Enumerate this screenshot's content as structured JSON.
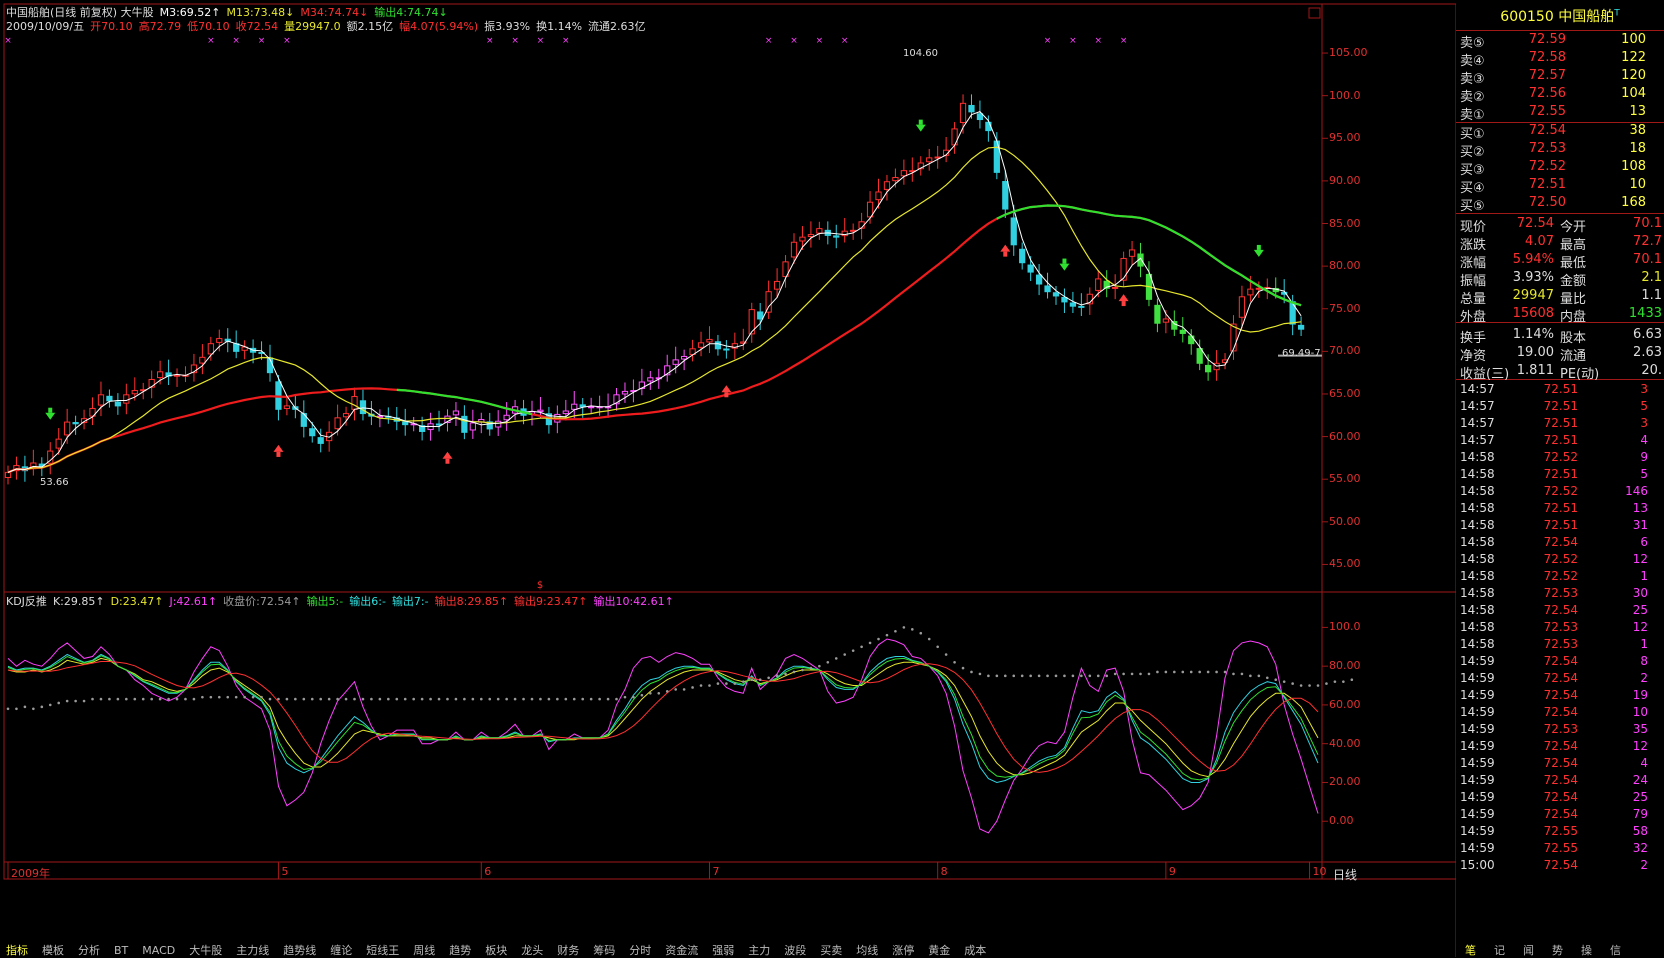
{
  "stock": {
    "code": "600150",
    "name": "中国船舶",
    "flag": "T"
  },
  "header": {
    "line1": [
      {
        "t": "中国船舶(日线 前复权) 大牛股",
        "c": "#dddddd"
      },
      {
        "t": "M3:69.52↑",
        "c": "#ffffff"
      },
      {
        "t": "M13:73.48↓",
        "c": "#e6e62e"
      },
      {
        "t": "M34:74.74↓",
        "c": "#ff3030"
      },
      {
        "t": "输出4:74.74↓",
        "c": "#30e030"
      }
    ],
    "line2": [
      {
        "t": "2009/10/09/五",
        "c": "#dddddd"
      },
      {
        "t": "开70.10",
        "c": "#ff3030"
      },
      {
        "t": "高72.79",
        "c": "#ff3030"
      },
      {
        "t": "低70.10",
        "c": "#ff3030"
      },
      {
        "t": "收72.54",
        "c": "#ff3030"
      },
      {
        "t": "量29947.0",
        "c": "#e6e62e"
      },
      {
        "t": "额2.15亿",
        "c": "#dddddd"
      },
      {
        "t": "幅4.07(5.94%)",
        "c": "#ff3030"
      },
      {
        "t": "振3.93%",
        "c": "#dddddd"
      },
      {
        "t": "换1.14%",
        "c": "#dddddd"
      },
      {
        "t": "流通2.63亿",
        "c": "#dddddd"
      }
    ]
  },
  "kdj_header": [
    {
      "t": "KDJ反推",
      "c": "#dddddd"
    },
    {
      "t": "K:29.85↑",
      "c": "#dddddd"
    },
    {
      "t": "D:23.47↑",
      "c": "#e6e62e"
    },
    {
      "t": "J:42.61↑",
      "c": "#ff40ff"
    },
    {
      "t": "收盘价:72.54↑",
      "c": "#9a9a9a"
    },
    {
      "t": "输出5:-",
      "c": "#30e030"
    },
    {
      "t": "输出6:-",
      "c": "#30e0e0"
    },
    {
      "t": "输出7:-",
      "c": "#30e0e0"
    },
    {
      "t": "输出8:29.85↑",
      "c": "#ff3030"
    },
    {
      "t": "输出9:23.47↑",
      "c": "#ff3030"
    },
    {
      "t": "输出10:42.61↑",
      "c": "#ff40ff"
    }
  ],
  "price_axis": [
    "105.00",
    "100.0",
    "95.00",
    "90.00",
    "85.00",
    "80.00",
    "75.00",
    "70.00",
    "65.00",
    "60.00",
    "55.00",
    "50.00",
    "45.00"
  ],
  "kdj_axis": [
    "100.0",
    "80.00",
    "60.00",
    "40.00",
    "20.00",
    "0.00"
  ],
  "x_labels": [
    "2009年",
    "5",
    "6",
    "7",
    "8",
    "9",
    "10"
  ],
  "annotations": {
    "high": "104.60",
    "low": "53.66",
    "last": "69.49-7"
  },
  "period_label": "日线",
  "quote": {
    "asks": [
      {
        "l": "卖⑤",
        "p": "72.59",
        "v": "100"
      },
      {
        "l": "卖④",
        "p": "72.58",
        "v": "122"
      },
      {
        "l": "卖③",
        "p": "72.57",
        "v": "120"
      },
      {
        "l": "卖②",
        "p": "72.56",
        "v": "104"
      },
      {
        "l": "卖①",
        "p": "72.55",
        "v": "13"
      }
    ],
    "bids": [
      {
        "l": "买①",
        "p": "72.54",
        "v": "38"
      },
      {
        "l": "买②",
        "p": "72.53",
        "v": "18"
      },
      {
        "l": "买③",
        "p": "72.52",
        "v": "108"
      },
      {
        "l": "买④",
        "p": "72.51",
        "v": "10"
      },
      {
        "l": "买⑤",
        "p": "72.50",
        "v": "168"
      }
    ],
    "stats": [
      {
        "l": "现价",
        "v": "72.54",
        "vc": "#ff3030",
        "l2": "今开",
        "v2": "70.1",
        "v2c": "#ff3030"
      },
      {
        "l": "涨跌",
        "v": "4.07",
        "vc": "#ff3030",
        "l2": "最高",
        "v2": "72.7",
        "v2c": "#ff3030"
      },
      {
        "l": "涨幅",
        "v": "5.94%",
        "vc": "#ff3030",
        "l2": "最低",
        "v2": "70.1",
        "v2c": "#ff3030"
      },
      {
        "l": "振幅",
        "v": "3.93%",
        "vc": "#dddddd",
        "l2": "金额",
        "v2": "2.1",
        "v2c": "#e6e62e"
      },
      {
        "l": "总量",
        "v": "29947",
        "vc": "#e6e62e",
        "l2": "量比",
        "v2": "1.1",
        "v2c": "#dddddd"
      },
      {
        "l": "外盘",
        "v": "15608",
        "vc": "#ff3030",
        "l2": "内盘",
        "v2": "1433",
        "v2c": "#30e030"
      },
      {
        "l": "换手",
        "v": "1.14%",
        "vc": "#dddddd",
        "l2": "股本",
        "v2": "6.63",
        "v2c": "#dddddd"
      },
      {
        "l": "净资",
        "v": "19.00",
        "vc": "#dddddd",
        "l2": "流通",
        "v2": "2.63",
        "v2c": "#dddddd"
      },
      {
        "l": "收益(三)",
        "v": "1.811",
        "vc": "#dddddd",
        "l2": "PE(动)",
        "v2": "20.",
        "v2c": "#dddddd"
      }
    ],
    "trades": [
      {
        "t": "14:57",
        "p": "72.51",
        "v": "3",
        "c": "#ff3030"
      },
      {
        "t": "14:57",
        "p": "72.51",
        "v": "5",
        "c": "#ff3030"
      },
      {
        "t": "14:57",
        "p": "72.51",
        "v": "3",
        "c": "#ff3030"
      },
      {
        "t": "14:57",
        "p": "72.51",
        "v": "4",
        "c": "#ff40ff"
      },
      {
        "t": "14:58",
        "p": "72.52",
        "v": "9",
        "c": "#ff40ff"
      },
      {
        "t": "14:58",
        "p": "72.51",
        "v": "5",
        "c": "#ff40ff"
      },
      {
        "t": "14:58",
        "p": "72.52",
        "v": "146",
        "c": "#ff40ff"
      },
      {
        "t": "14:58",
        "p": "72.51",
        "v": "13",
        "c": "#ff40ff"
      },
      {
        "t": "14:58",
        "p": "72.51",
        "v": "31",
        "c": "#ff40ff"
      },
      {
        "t": "14:58",
        "p": "72.54",
        "v": "6",
        "c": "#ff40ff"
      },
      {
        "t": "14:58",
        "p": "72.52",
        "v": "12",
        "c": "#ff40ff"
      },
      {
        "t": "14:58",
        "p": "72.52",
        "v": "1",
        "c": "#ff40ff"
      },
      {
        "t": "14:58",
        "p": "72.53",
        "v": "30",
        "c": "#ff40ff"
      },
      {
        "t": "14:58",
        "p": "72.54",
        "v": "25",
        "c": "#ff40ff"
      },
      {
        "t": "14:58",
        "p": "72.53",
        "v": "12",
        "c": "#ff40ff"
      },
      {
        "t": "14:58",
        "p": "72.53",
        "v": "1",
        "c": "#ff40ff"
      },
      {
        "t": "14:59",
        "p": "72.54",
        "v": "8",
        "c": "#ff40ff"
      },
      {
        "t": "14:59",
        "p": "72.54",
        "v": "2",
        "c": "#ff40ff"
      },
      {
        "t": "14:59",
        "p": "72.54",
        "v": "19",
        "c": "#ff40ff"
      },
      {
        "t": "14:59",
        "p": "72.54",
        "v": "10",
        "c": "#ff40ff"
      },
      {
        "t": "14:59",
        "p": "72.53",
        "v": "35",
        "c": "#ff40ff"
      },
      {
        "t": "14:59",
        "p": "72.54",
        "v": "12",
        "c": "#ff40ff"
      },
      {
        "t": "14:59",
        "p": "72.54",
        "v": "4",
        "c": "#ff40ff"
      },
      {
        "t": "14:59",
        "p": "72.54",
        "v": "24",
        "c": "#ff40ff"
      },
      {
        "t": "14:59",
        "p": "72.54",
        "v": "25",
        "c": "#ff40ff"
      },
      {
        "t": "14:59",
        "p": "72.54",
        "v": "79",
        "c": "#ff40ff"
      },
      {
        "t": "14:59",
        "p": "72.55",
        "v": "58",
        "c": "#ff40ff"
      },
      {
        "t": "14:59",
        "p": "72.55",
        "v": "32",
        "c": "#ff40ff"
      },
      {
        "t": "15:00",
        "p": "72.54",
        "v": "2",
        "c": "#ff40ff"
      }
    ]
  },
  "bottom_tabs": [
    "指标",
    "模板",
    "分析",
    "BT",
    "MACD",
    "大牛股",
    "主力线",
    "趋势线",
    "缠论",
    "短线王",
    "周线",
    "趋势",
    "板块",
    "龙头",
    "财务",
    "筹码",
    "分时",
    "资金流",
    "强弱",
    "主力",
    "波段",
    "买卖",
    "均线",
    "涨停",
    "黄金",
    "成本"
  ],
  "right_tabs": [
    "笔",
    "记",
    "闻",
    "势",
    "操",
    "信"
  ],
  "chart_data": {
    "type": "candlestick",
    "title": "中国船舶(日线 前复权)",
    "ylim": [
      42,
      107
    ],
    "kdj_ylim": [
      -20,
      110
    ],
    "n": 156,
    "xlabel_positions": [
      0,
      32,
      56,
      83,
      110,
      137,
      154
    ],
    "closes": [
      55.8,
      56.6,
      56.0,
      56.9,
      56.4,
      58.3,
      59.7,
      61.7,
      61.5,
      62.1,
      63.3,
      64.9,
      64.2,
      63.6,
      64.9,
      65.4,
      65.5,
      66.7,
      67.6,
      67.1,
      67.2,
      67.2,
      68.4,
      69.3,
      70.9,
      71.5,
      71.2,
      70.0,
      70.5,
      69.9,
      69.8,
      67.5,
      63.2,
      63.6,
      63.2,
      61.2,
      60.1,
      59.2,
      60.5,
      62.2,
      62.7,
      64.7,
      62.7,
      62.4,
      62.4,
      62.3,
      61.8,
      61.4,
      61.5,
      60.6,
      61.5,
      61.4,
      62.4,
      63.0,
      60.5,
      61.6,
      62.0,
      60.9,
      61.8,
      62.5,
      63.5,
      62.5,
      62.9,
      63.1,
      61.4,
      62.6,
      63.0,
      63.8,
      63.5,
      63.5,
      63.5,
      63.5,
      64.9,
      65.3,
      65.4,
      66.4,
      66.9,
      66.9,
      68.3,
      69.0,
      69.4,
      70.3,
      71.0,
      71.4,
      70.3,
      70.2,
      70.9,
      71.1,
      74.9,
      73.8,
      77.0,
      78.2,
      80.5,
      82.8,
      83.4,
      83.7,
      84.4,
      83.6,
      83.4,
      84.1,
      84.2,
      85.2,
      87.5,
      88.7,
      89.9,
      90.4,
      91.2,
      91.2,
      92.1,
      92.7,
      92.8,
      93.6,
      96.1,
      99.1,
      98.1,
      97.2,
      95.9,
      91.0,
      86.7,
      82.5,
      80.4,
      79.3,
      77.9,
      77.0,
      76.5,
      75.8,
      75.3,
      75.2,
      76.7,
      78.5,
      77.4,
      77.5,
      80.9,
      81.9,
      80.0,
      76.1,
      73.3,
      73.8,
      72.6,
      72.1,
      70.9,
      68.6,
      67.6,
      68.6,
      69.0,
      73.2,
      76.4,
      77.3,
      77.4,
      77.5,
      77.0,
      76.7,
      73.2,
      72.6
    ],
    "k": [
      80,
      78,
      79,
      79,
      78,
      80,
      83,
      86,
      84,
      82,
      83,
      86,
      84,
      80,
      78,
      75,
      72,
      70,
      68,
      66,
      66,
      68,
      73,
      78,
      82,
      82,
      78,
      72,
      68,
      65,
      62,
      55,
      38,
      30,
      27,
      25,
      27,
      32,
      38,
      44,
      49,
      54,
      51,
      47,
      44,
      44,
      45,
      45,
      45,
      42,
      42,
      42,
      42,
      44,
      42,
      42,
      44,
      43,
      43,
      44,
      46,
      44,
      44,
      45,
      41,
      42,
      42,
      43,
      43,
      43,
      43,
      45,
      52,
      58,
      65,
      70,
      73,
      74,
      77,
      79,
      80,
      80,
      79,
      79,
      76,
      73,
      71,
      70,
      75,
      70,
      72,
      74,
      78,
      80,
      80,
      79,
      78,
      73,
      69,
      68,
      68,
      71,
      77,
      81,
      84,
      85,
      85,
      83,
      82,
      80,
      77,
      72,
      63,
      50,
      40,
      28,
      22,
      20,
      21,
      23,
      25,
      28,
      31,
      33,
      34,
      38,
      48,
      57,
      56,
      57,
      64,
      67,
      63,
      52,
      43,
      40,
      36,
      32,
      27,
      22,
      20,
      20,
      22,
      32,
      46,
      56,
      62,
      67,
      70,
      72,
      71,
      64,
      57,
      50,
      40,
      30
    ],
    "d": [
      78,
      77,
      77,
      78,
      77,
      78,
      80,
      83,
      82,
      81,
      82,
      84,
      83,
      80,
      78,
      76,
      73,
      72,
      70,
      68,
      67,
      68,
      71,
      75,
      78,
      79,
      77,
      73,
      70,
      67,
      64,
      59,
      48,
      41,
      35,
      30,
      28,
      28,
      31,
      35,
      40,
      45,
      47,
      46,
      45,
      44,
      44,
      44,
      44,
      43,
      43,
      42,
      42,
      43,
      42,
      42,
      43,
      43,
      43,
      43,
      44,
      44,
      44,
      44,
      43,
      42,
      42,
      42,
      43,
      43,
      43,
      44,
      48,
      53,
      58,
      63,
      67,
      70,
      73,
      75,
      77,
      78,
      78,
      78,
      77,
      75,
      73,
      72,
      73,
      71,
      72,
      73,
      75,
      77,
      78,
      78,
      78,
      76,
      73,
      71,
      70,
      70,
      73,
      76,
      79,
      81,
      82,
      82,
      81,
      80,
      78,
      75,
      70,
      62,
      54,
      44,
      36,
      30,
      26,
      24,
      24,
      25,
      27,
      29,
      31,
      34,
      40,
      46,
      49,
      52,
      57,
      61,
      61,
      57,
      52,
      48,
      44,
      40,
      35,
      30,
      26,
      24,
      23,
      26,
      32,
      40,
      47,
      54,
      59,
      63,
      66,
      66,
      63,
      59,
      51,
      43
    ],
    "j": [
      84,
      80,
      83,
      81,
      80,
      84,
      89,
      92,
      88,
      84,
      85,
      90,
      86,
      80,
      78,
      73,
      70,
      66,
      64,
      62,
      64,
      68,
      77,
      84,
      90,
      88,
      80,
      70,
      64,
      61,
      58,
      47,
      18,
      8,
      11,
      15,
      25,
      40,
      52,
      62,
      67,
      72,
      59,
      49,
      42,
      44,
      47,
      47,
      47,
      40,
      40,
      42,
      42,
      46,
      42,
      42,
      46,
      43,
      43,
      46,
      50,
      44,
      44,
      47,
      37,
      42,
      42,
      45,
      43,
      43,
      43,
      47,
      60,
      68,
      79,
      84,
      85,
      82,
      85,
      87,
      86,
      84,
      81,
      81,
      74,
      69,
      67,
      66,
      79,
      68,
      72,
      76,
      84,
      86,
      84,
      81,
      78,
      67,
      61,
      62,
      64,
      73,
      85,
      91,
      94,
      93,
      91,
      85,
      84,
      80,
      75,
      66,
      49,
      26,
      12,
      -4,
      -6,
      0,
      11,
      21,
      27,
      34,
      39,
      41,
      40,
      46,
      64,
      79,
      70,
      67,
      78,
      79,
      67,
      42,
      25,
      24,
      20,
      16,
      11,
      6,
      8,
      12,
      20,
      44,
      74,
      88,
      92,
      93,
      92,
      90,
      81,
      60,
      45,
      32,
      18,
      4
    ],
    "dots": [
      58,
      58,
      59,
      58,
      59,
      60,
      61,
      62,
      62,
      62,
      63,
      63,
      63,
      63,
      63,
      63,
      63,
      63,
      63,
      63,
      63,
      63,
      63,
      64,
      64,
      64,
      64,
      64,
      64,
      64,
      64,
      63,
      63,
      63,
      63,
      63,
      63,
      63,
      63,
      63,
      63,
      63,
      63,
      63,
      63,
      63,
      63,
      63,
      63,
      63,
      63,
      63,
      63,
      63,
      63,
      63,
      63,
      63,
      63,
      63,
      63,
      63,
      63,
      63,
      63,
      63,
      63,
      63,
      63,
      63,
      63,
      63,
      63,
      64,
      64,
      65,
      66,
      66,
      67,
      68,
      68,
      69,
      70,
      70,
      71,
      71,
      71,
      72,
      73,
      73,
      74,
      75,
      76,
      77,
      78,
      79,
      80,
      82,
      84,
      86,
      88,
      90,
      92,
      94,
      96,
      98,
      100,
      99,
      97,
      94,
      90,
      86,
      82,
      79,
      77,
      76,
      75,
      75,
      75,
      75,
      75,
      75,
      75,
      75,
      75,
      75,
      75,
      75,
      75,
      75,
      75,
      76,
      76,
      76,
      76,
      76,
      77,
      77,
      77,
      77,
      77,
      77,
      77,
      77,
      77,
      76,
      76,
      75,
      75,
      74,
      73,
      72,
      71,
      70,
      70,
      70,
      71,
      72,
      72,
      73
    ]
  }
}
